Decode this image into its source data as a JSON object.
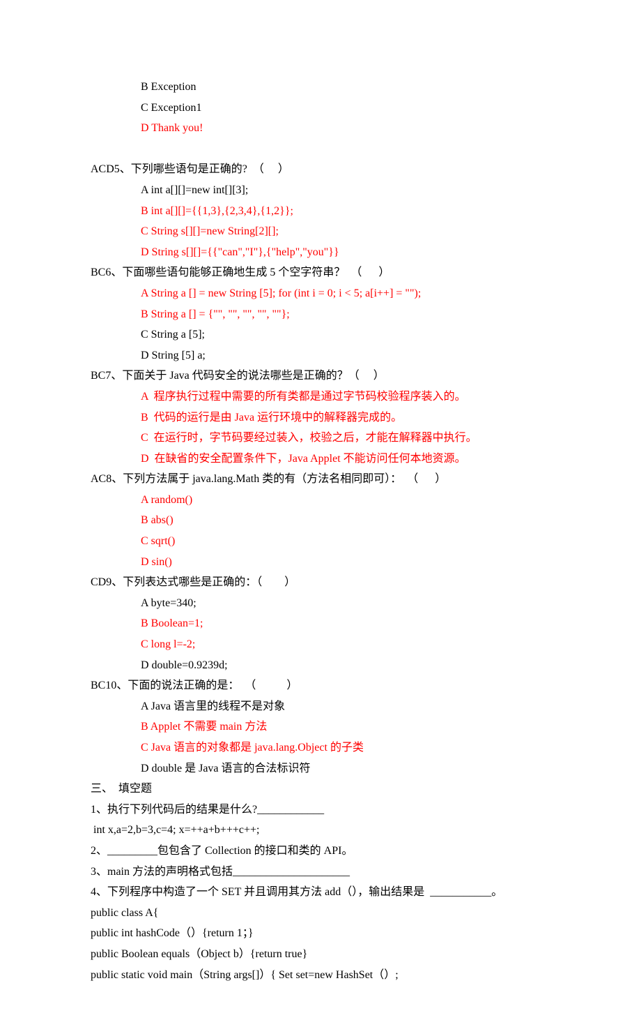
{
  "lines": [
    {
      "cls": "indent-opt",
      "segs": [
        {
          "t": "B Exception"
        }
      ]
    },
    {
      "cls": "indent-opt",
      "segs": [
        {
          "t": "C Exception1"
        }
      ]
    },
    {
      "cls": "indent-opt",
      "segs": [
        {
          "t": "D Thank you!",
          "red": true
        }
      ]
    },
    {
      "cls": "",
      "segs": [
        {
          "t": " "
        }
      ]
    },
    {
      "cls": "",
      "segs": [
        {
          "t": "ACD5、下列哪些语句是正确的?  （     ）"
        }
      ]
    },
    {
      "cls": "indent-opt",
      "segs": [
        {
          "t": "A int a[][]=new int[][3];"
        }
      ]
    },
    {
      "cls": "indent-opt",
      "segs": [
        {
          "t": "B int a[][]={{1,3},{2,3,4},{1,2}};",
          "red": true
        }
      ]
    },
    {
      "cls": "indent-opt",
      "segs": [
        {
          "t": "C String s[][]=new String[2][];",
          "red": true
        }
      ]
    },
    {
      "cls": "indent-opt",
      "segs": [
        {
          "t": "D String s[][]={{\"can\",\"I\"},{\"help\",\"you\"}}",
          "red": true
        }
      ]
    },
    {
      "cls": "",
      "segs": [
        {
          "t": "BC6、下面哪些语句能够正确地生成 5 个空字符串？  （      ）"
        }
      ]
    },
    {
      "cls": "indent-opt",
      "segs": [
        {
          "t": "A String a [] = new String [5]; for (int i = 0; i < 5; a[i++] = \"\");",
          "red": true
        }
      ]
    },
    {
      "cls": "indent-opt",
      "segs": [
        {
          "t": "B String a [] = {\"\", \"\", \"\", \"\", \"\"};",
          "red": true
        }
      ]
    },
    {
      "cls": "indent-opt",
      "segs": [
        {
          "t": "C String a [5];"
        }
      ]
    },
    {
      "cls": "indent-opt",
      "segs": [
        {
          "t": "D String [5] a;"
        }
      ]
    },
    {
      "cls": "",
      "segs": [
        {
          "t": "BC7、下面关于 Java 代码安全的说法哪些是正确的？（     ）"
        }
      ]
    },
    {
      "cls": "indent-opt",
      "segs": [
        {
          "t": "A  程序执行过程中需要的所有类都是通过字节码校验程序装入的。",
          "red": true
        }
      ]
    },
    {
      "cls": "indent-opt",
      "segs": [
        {
          "t": "B  代码的运行是由 Java 运行环境中的解释器完成的。",
          "red": true
        }
      ]
    },
    {
      "cls": "indent-opt",
      "segs": [
        {
          "t": "C  在运行时，字节码要经过装入，校验之后，才能在解释器中执行。",
          "red": true
        }
      ]
    },
    {
      "cls": "indent-opt",
      "segs": [
        {
          "t": "D  在缺省的安全配置条件下，Java Applet 不能访问任何本地资源。",
          "red": true
        }
      ]
    },
    {
      "cls": "",
      "segs": [
        {
          "t": "AC8、下列方法属于 java.lang.Math 类的有（方法名相同即可）：  （      ）"
        }
      ]
    },
    {
      "cls": "indent-opt",
      "segs": [
        {
          "t": "A random()",
          "red": true
        }
      ]
    },
    {
      "cls": "indent-opt",
      "segs": [
        {
          "t": "B abs()",
          "red": true
        }
      ]
    },
    {
      "cls": "indent-opt",
      "segs": [
        {
          "t": "C sqrt()",
          "red": true
        }
      ]
    },
    {
      "cls": "indent-opt",
      "segs": [
        {
          "t": "D sin()",
          "red": true
        }
      ]
    },
    {
      "cls": "",
      "segs": [
        {
          "t": "CD9、下列表达式哪些是正确的：（        ）"
        }
      ]
    },
    {
      "cls": "indent-opt",
      "segs": [
        {
          "t": "A byte=340;"
        }
      ]
    },
    {
      "cls": "indent-opt",
      "segs": [
        {
          "t": "B Boolean=1;",
          "red": true
        }
      ]
    },
    {
      "cls": "indent-opt",
      "segs": [
        {
          "t": "C long l=-2;",
          "red": true
        }
      ]
    },
    {
      "cls": "indent-opt",
      "segs": [
        {
          "t": "D double=0.9239d;"
        }
      ]
    },
    {
      "cls": "",
      "segs": [
        {
          "t": "BC10、下面的说法正确的是：  （           ）"
        }
      ]
    },
    {
      "cls": "indent-opt",
      "segs": [
        {
          "t": "A Java 语言里的线程不是对象"
        }
      ]
    },
    {
      "cls": "indent-opt",
      "segs": [
        {
          "t": "B Applet 不需要 main 方法",
          "red": true
        }
      ]
    },
    {
      "cls": "indent-opt",
      "segs": [
        {
          "t": "C Java 语言的对象都是 java.lang.Object 的子类",
          "red": true
        }
      ]
    },
    {
      "cls": "indent-opt",
      "segs": [
        {
          "t": "D double 是 Java 语言的合法标识符"
        }
      ]
    },
    {
      "cls": "",
      "segs": [
        {
          "t": "三、  填空题"
        }
      ]
    },
    {
      "cls": "",
      "segs": [
        {
          "t": "1、执行下列代码后的结果是什么?____________"
        }
      ]
    },
    {
      "cls": "",
      "segs": [
        {
          "t": " int x,a=2,b=3,c=4; x=++a+b+++c++;"
        }
      ]
    },
    {
      "cls": "",
      "segs": [
        {
          "t": "2、_________包包含了 Collection 的接口和类的 API。"
        }
      ]
    },
    {
      "cls": "",
      "segs": [
        {
          "t": "3、main 方法的声明格式包括_____________________"
        }
      ]
    },
    {
      "cls": "",
      "segs": [
        {
          "t": "4、下列程序中构造了一个 SET 并且调用其方法 add（），输出结果是  ___________。"
        }
      ]
    },
    {
      "cls": "",
      "segs": [
        {
          "t": "public class A{"
        }
      ]
    },
    {
      "cls": "",
      "segs": [
        {
          "t": "public int hashCode（）{return 1；}"
        }
      ]
    },
    {
      "cls": "",
      "segs": [
        {
          "t": "public Boolean equals（Object b）{return true}"
        }
      ]
    },
    {
      "cls": "",
      "segs": [
        {
          "t": "public static void main（String args[]）{ Set set=new HashSet（）;"
        }
      ]
    }
  ]
}
